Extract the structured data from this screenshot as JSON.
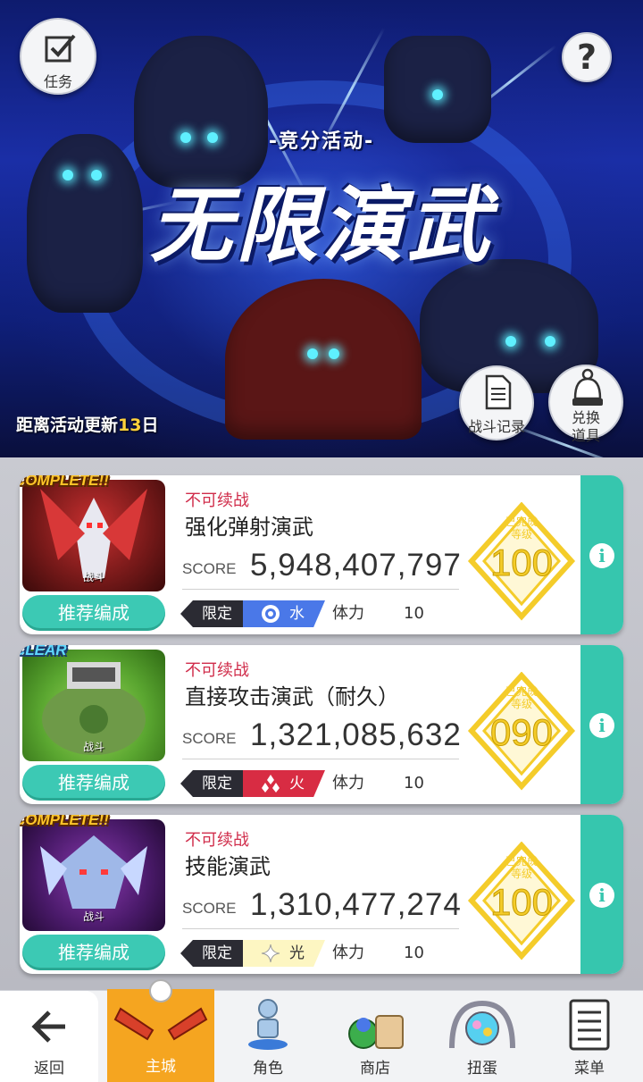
{
  "banner": {
    "subtitle": "-竞分活动-",
    "title": "无限演武",
    "countdown_prefix": "距离活动更新",
    "countdown_days": "13",
    "countdown_suffix": "日"
  },
  "buttons": {
    "task_label": "任务",
    "help_label": "?",
    "battle_log_label": "战斗记录",
    "exchange_label_line1": "兑换",
    "exchange_label_line2": "道具"
  },
  "common": {
    "no_continue": "不可续战",
    "score_label": "SCORE",
    "recommend_label": "推荐编成",
    "limit_label": "限定",
    "stamina_label": "体力",
    "thumb_tag": "战斗",
    "medal_caption_line1": "已完成",
    "medal_caption_line2": "等级"
  },
  "stages": [
    {
      "status": "COMPLETE!!",
      "name": "强化弹射演武",
      "score": "5,948,407,797",
      "element": "水",
      "element_icon": "water-orb-icon",
      "stamina": "10",
      "grade": "100",
      "thumb_color": "#7a1a1a"
    },
    {
      "status": "CLEAR",
      "name": "直接攻击演武（耐久）",
      "score": "1,321,085,632",
      "element": "火",
      "element_icon": "fire-diamonds-icon",
      "stamina": "10",
      "grade": "090",
      "thumb_color": "#4f9a2a"
    },
    {
      "status": "COMPLETE!!",
      "name": "技能演武",
      "score": "1,310,477,274",
      "element": "光",
      "element_icon": "light-sparkle-icon",
      "stamina": "10",
      "grade": "100",
      "thumb_color": "#4a1a6a"
    }
  ],
  "nav": {
    "back": "返回",
    "home": "主城",
    "character": "角色",
    "shop": "商店",
    "gacha": "扭蛋",
    "menu": "菜单"
  },
  "colors": {
    "accent_teal": "#36c6ae",
    "warning_red": "#d02c4a",
    "medal_gold": "#f4cc2a",
    "home_orange": "#f5a520"
  }
}
